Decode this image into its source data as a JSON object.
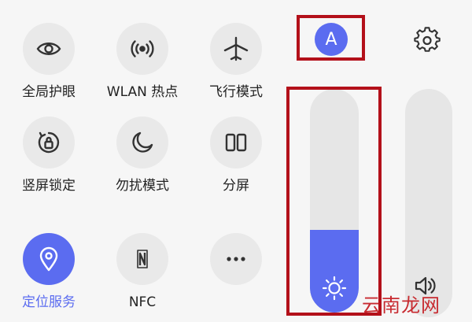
{
  "colors": {
    "accent": "#5b6cf0",
    "tile_bg": "#e9e9e9",
    "highlight_box": "#b3101a",
    "watermark": "#c4161c"
  },
  "tiles": [
    {
      "label": "全局护眼",
      "icon": "eye-icon",
      "active": false
    },
    {
      "label": "WLAN 热点",
      "icon": "hotspot-icon",
      "active": false
    },
    {
      "label": "飞行模式",
      "icon": "airplane-icon",
      "active": false
    },
    {
      "label": "竖屏锁定",
      "icon": "rotation-lock-icon",
      "active": false
    },
    {
      "label": "勿扰模式",
      "icon": "moon-icon",
      "active": false
    },
    {
      "label": "分屏",
      "icon": "split-screen-icon",
      "active": false
    },
    {
      "label": "定位服务",
      "icon": "location-icon",
      "active": true
    },
    {
      "label": "NFC",
      "icon": "nfc-icon",
      "active": false
    },
    {
      "label": "",
      "icon": "more-icon",
      "active": false
    }
  ],
  "auto_brightness": {
    "letter": "A"
  },
  "settings_icon": "gear-icon",
  "brightness": {
    "icon": "sun-icon",
    "level_percent": 37
  },
  "volume": {
    "icon": "speaker-icon"
  },
  "watermark": {
    "text": "云南龙网"
  }
}
